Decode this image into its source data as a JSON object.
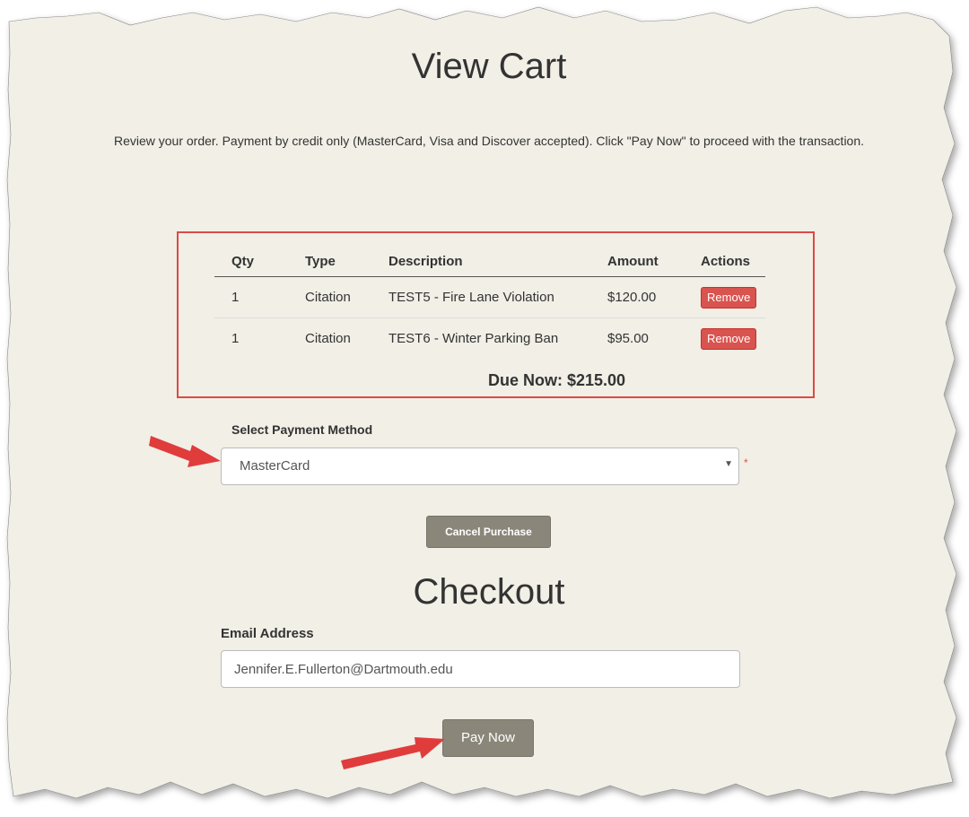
{
  "page": {
    "title": "View Cart",
    "intro": "Review your order. Payment by credit only (MasterCard, Visa and Discover accepted). Click \"Pay Now\" to proceed with the transaction.",
    "background_color": "#f1efe6",
    "highlight_color": "#dc4a45"
  },
  "cart": {
    "headers": [
      "Qty",
      "Type",
      "Description",
      "Amount",
      "Actions"
    ],
    "rows": [
      {
        "qty": "1",
        "type": "Citation",
        "description": "TEST5 - Fire Lane Violation",
        "amount": "$120.00",
        "action": "Remove"
      },
      {
        "qty": "1",
        "type": "Citation",
        "description": "TEST6 - Winter Parking Ban",
        "amount": "$95.00",
        "action": "Remove"
      }
    ],
    "due_now": "Due Now: $215.00"
  },
  "payment": {
    "label": "Select Payment Method",
    "selected": "MasterCard",
    "required_mark": "*"
  },
  "cancel_label": "Cancel Purchase",
  "checkout": {
    "title": "Checkout",
    "email_label": "Email Address",
    "email_value": "Jennifer.E.Fullerton@Dartmouth.edu",
    "pay_label": "Pay Now"
  },
  "annotations": {
    "arrow_color": "#e03c3c"
  }
}
